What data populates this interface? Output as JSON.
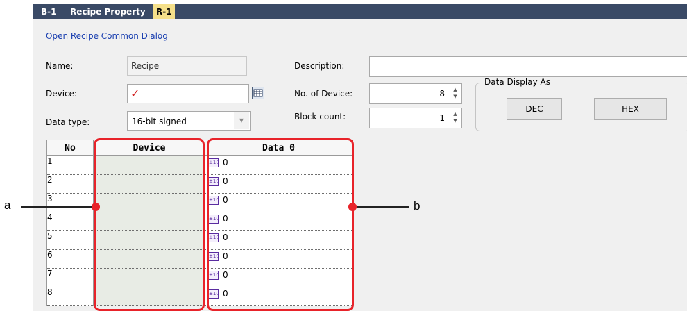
{
  "tabs": [
    {
      "label": "B-1"
    },
    {
      "label": "Recipe Property"
    },
    {
      "label": "R-1"
    }
  ],
  "open_dialog_link": "Open Recipe Common Dialog",
  "form": {
    "name_label": "Name:",
    "name_value": "Recipe",
    "device_label": "Device:",
    "device_value": "✓",
    "data_type_label": "Data type:",
    "data_type_value": "16-bit signed",
    "description_label": "Description:",
    "description_value": "",
    "no_of_device_label": "No. of Device:",
    "no_of_device_value": "8",
    "block_count_label": "Block count:",
    "block_count_value": "1"
  },
  "data_display": {
    "title": "Data Display As",
    "dec_label": "DEC",
    "hex_label": "HEX"
  },
  "grid": {
    "headers": {
      "no": "No",
      "device": "Device",
      "data": "Data 0"
    },
    "rows": [
      {
        "no": "1",
        "device": "",
        "value": "0"
      },
      {
        "no": "2",
        "device": "",
        "value": "0"
      },
      {
        "no": "3",
        "device": "",
        "value": "0"
      },
      {
        "no": "4",
        "device": "",
        "value": "0"
      },
      {
        "no": "5",
        "device": "",
        "value": "0"
      },
      {
        "no": "6",
        "device": "",
        "value": "0"
      },
      {
        "no": "7",
        "device": "",
        "value": "0"
      },
      {
        "no": "8",
        "device": "",
        "value": "0"
      }
    ],
    "value_icon": "±10"
  },
  "callouts": {
    "a": "a",
    "b": "b"
  },
  "colors": {
    "highlight": "#e8232a",
    "tabbar": "#3a4a66",
    "active_tab": "#f5e08a",
    "link": "#1a3fb0"
  }
}
